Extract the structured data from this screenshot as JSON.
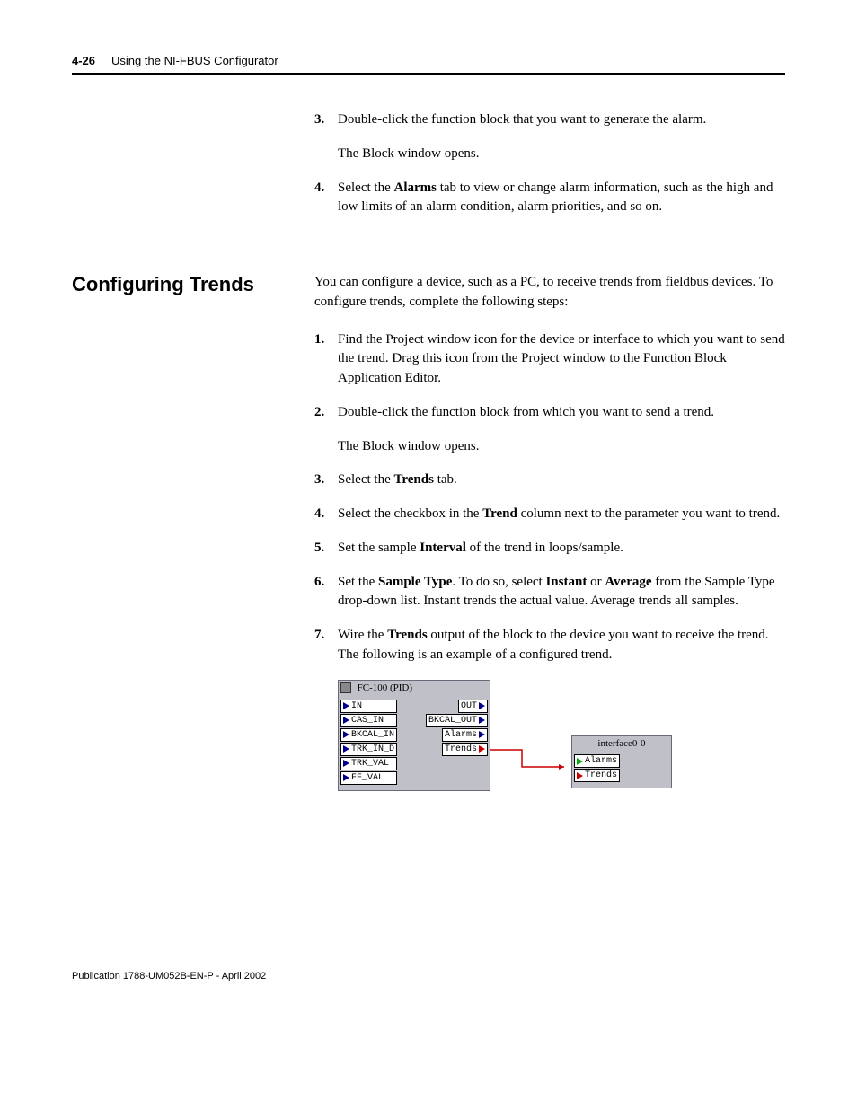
{
  "header": {
    "page_number": "4-26",
    "title": "Using the NI-FBUS Configurator"
  },
  "top_list": {
    "item3_num": "3.",
    "item3_text_a": "Double-click the function block that you want to generate the alarm.",
    "item3_para": "The Block window opens.",
    "item4_num": "4.",
    "item4_text_a": "Select the ",
    "item4_bold": "Alarms",
    "item4_text_b": " tab to view or change alarm information, such as the high and low limits of an alarm condition, alarm priorities, and so on."
  },
  "section": {
    "heading": "Configuring Trends",
    "intro": "You can configure a device, such as a PC, to receive trends from fieldbus devices. To configure trends, complete the following steps:",
    "item1_num": "1.",
    "item1_text": "Find the Project window icon for the device or interface to which you want to send the trend. Drag this icon from the Project window to the Function Block Application Editor.",
    "item2_num": "2.",
    "item2_text": "Double-click the function block from which you want to send a trend.",
    "item2_para": "The Block window opens.",
    "item3_num": "3.",
    "item3_text_a": "Select the ",
    "item3_bold": "Trends",
    "item3_text_b": " tab.",
    "item4_num": "4.",
    "item4_text_a": "Select the checkbox in the ",
    "item4_bold": "Trend",
    "item4_text_b": " column next to the parameter you want to trend.",
    "item5_num": "5.",
    "item5_text_a": "Set the sample ",
    "item5_bold": "Interval",
    "item5_text_b": " of the trend in loops/sample.",
    "item6_num": "6.",
    "item6_text_a": "Set the ",
    "item6_bold_a": "Sample Type",
    "item6_text_b": ". To do so, select ",
    "item6_bold_b": "Instant",
    "item6_text_c": " or ",
    "item6_bold_c": "Average",
    "item6_text_d": " from the Sample Type drop-down list. Instant trends the actual value. Average trends all samples.",
    "item7_num": "7.",
    "item7_text_a": "Wire the ",
    "item7_bold": "Trends",
    "item7_text_b": " output of the block to the device you want to receive the trend. The following is an example of a configured trend."
  },
  "figure": {
    "block_title": "FC-100 (PID)",
    "ports_in": [
      "IN",
      "CAS_IN",
      "BKCAL_IN",
      "TRK_IN_D",
      "TRK_VAL",
      "FF_VAL"
    ],
    "ports_out": [
      "OUT",
      "BKCAL_OUT",
      "Alarms",
      "Trends"
    ],
    "iface_title": "interface0-0",
    "iface_ports": [
      "Alarms",
      "Trends"
    ]
  },
  "footer": {
    "text": "Publication 1788-UM052B-EN-P - April 2002"
  }
}
